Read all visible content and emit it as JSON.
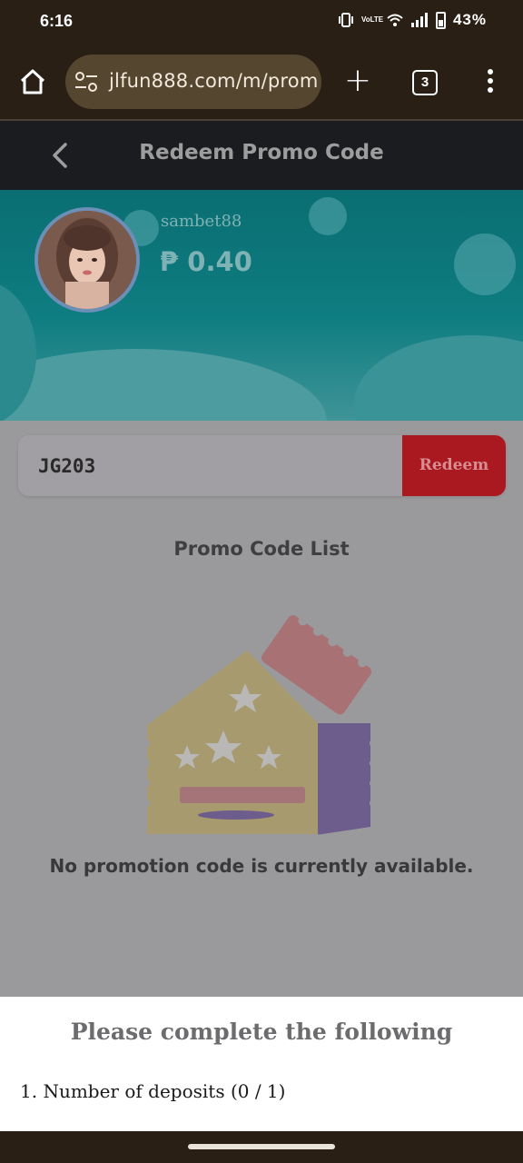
{
  "status_bar": {
    "time": "6:16",
    "volte_label": "VoLTE",
    "battery_percent": "43%"
  },
  "browser": {
    "url": "jlfun888.com/m/prom",
    "tab_count": "3"
  },
  "header": {
    "title": "Redeem Promo Code"
  },
  "profile": {
    "username": "sambet88",
    "balance": "₱ 0.40"
  },
  "promo": {
    "input_value": "JG203",
    "redeem_label": "Redeem",
    "list_title": "Promo Code List",
    "empty_message": "No promotion code is currently available."
  },
  "sheet": {
    "title": "Please complete the following",
    "items": [
      "1. Number of deposits (0 / 1)"
    ]
  },
  "colors": {
    "banner_teal": "#0e7d81",
    "redeem_red": "#a9191f",
    "overlay_gray": "#9a999c"
  }
}
